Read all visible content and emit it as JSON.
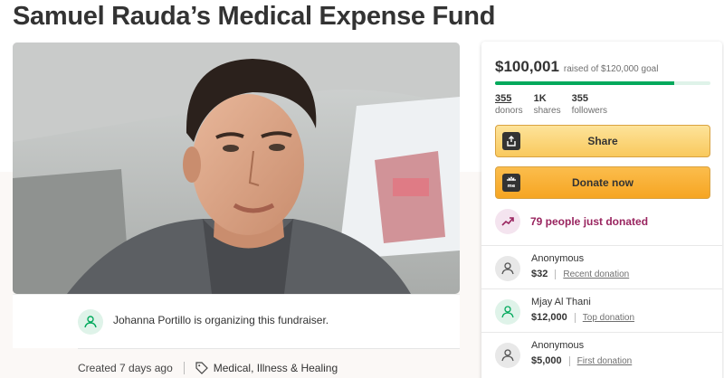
{
  "page": {
    "title": "Samuel Rauda’s Medical Expense Fund"
  },
  "colors": {
    "brand_green": "#02a95c",
    "button_yellow": "#f9c95d",
    "button_orange": "#f6a522",
    "trending_magenta": "#99245f"
  },
  "photo": {
    "subject": "selfie of a young man in a car"
  },
  "organizer": {
    "icon": "user-hand-icon",
    "text": "Johanna Portillo is organizing this fundraiser."
  },
  "meta": {
    "created": "Created 7 days ago",
    "category_icon": "tag-icon",
    "category": "Medical, Illness & Healing"
  },
  "sidebar": {
    "raised": "$100,001",
    "goal_text": "raised of $120,000 goal",
    "progress_fraction": 0.833,
    "stats": [
      {
        "value": "355",
        "label": "donors"
      },
      {
        "value": "1K",
        "label": "shares"
      },
      {
        "value": "355",
        "label": "followers"
      }
    ],
    "share_label": "Share",
    "donate_label": "Donate now",
    "trending_text": "79 people just donated",
    "donations": [
      {
        "name": "Anonymous",
        "amount": "$32",
        "kind": "Recent donation"
      },
      {
        "name": "Mjay Al Thani",
        "amount": "$12,000",
        "kind": "Top donation"
      },
      {
        "name": "Anonymous",
        "amount": "$5,000",
        "kind": "First donation"
      }
    ]
  }
}
